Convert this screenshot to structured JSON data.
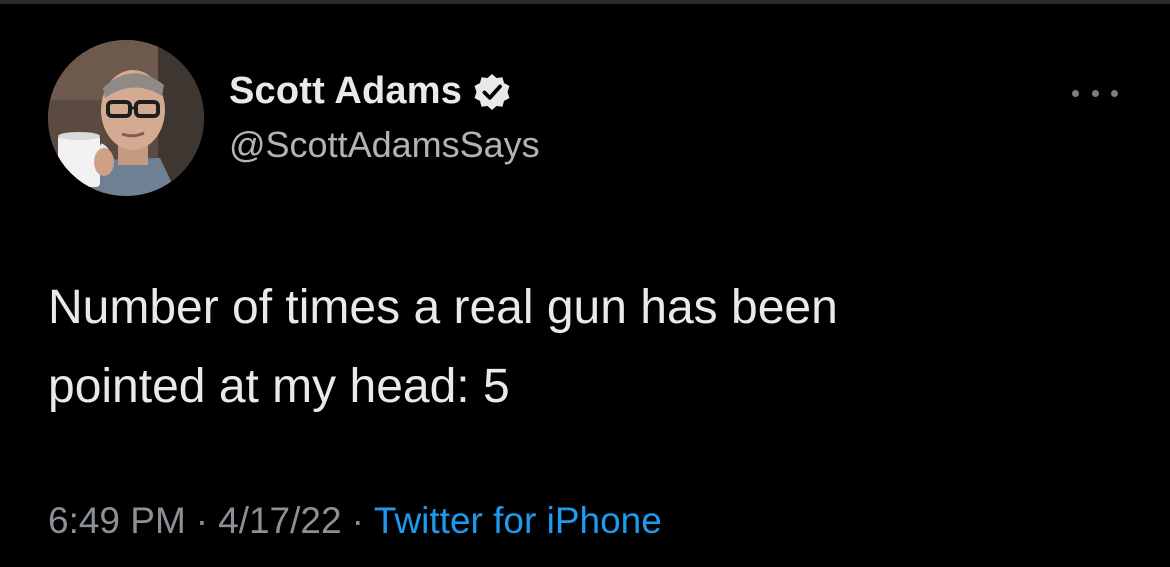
{
  "tweet": {
    "author": {
      "display_name": "Scott Adams",
      "handle": "@ScottAdamsSays",
      "verified": true,
      "avatar_icon": "profile-photo"
    },
    "more_icon": "more-horizontal-icon",
    "text": "Number of times a real gun has been\npointed at my head: 5",
    "time": "6:49 PM",
    "date": "4/17/22",
    "separator": "·",
    "source": "Twitter for iPhone"
  },
  "colors": {
    "background": "#000000",
    "primary_text": "#e7e9ea",
    "secondary_text": "#8b9096",
    "link": "#1d9bf0"
  }
}
